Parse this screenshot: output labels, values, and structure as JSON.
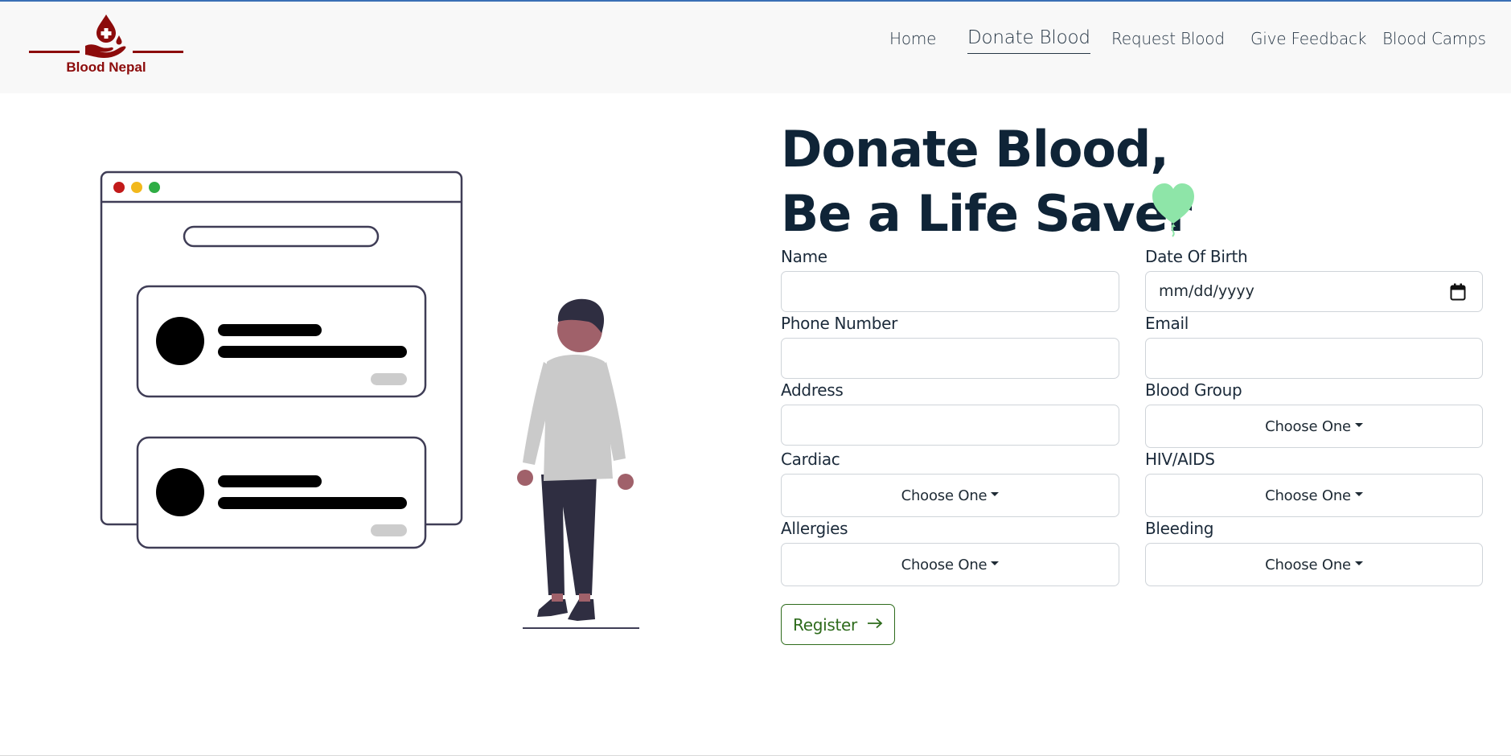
{
  "brand": {
    "name": "Blood Nepal",
    "logo_icon": "hand-blood-drop-icon",
    "color": "#8c0b0b"
  },
  "nav": {
    "items": [
      {
        "label": "Home",
        "active": false
      },
      {
        "label": "Donate Blood",
        "active": true
      },
      {
        "label": "Request Blood",
        "active": false
      },
      {
        "label": "Give Feedback",
        "active": false
      },
      {
        "label": "Blood Camps",
        "active": false
      }
    ]
  },
  "hero": {
    "title_line1": "Donate Blood,",
    "title_line2": "Be a Life Saver",
    "balloon_icon": "heart-balloon-icon",
    "balloon_color": "#8ee5a8"
  },
  "form": {
    "name": {
      "label": "Name",
      "value": "",
      "placeholder": ""
    },
    "dob": {
      "label": "Date Of Birth",
      "placeholder": "mm/dd/yyyy",
      "icon": "calendar-icon"
    },
    "phone": {
      "label": "Phone Number",
      "value": "",
      "placeholder": ""
    },
    "email": {
      "label": "Email",
      "value": "",
      "placeholder": ""
    },
    "address": {
      "label": "Address",
      "value": "",
      "placeholder": ""
    },
    "blood_group": {
      "label": "Blood Group",
      "selected": "Choose One"
    },
    "cardiac": {
      "label": "Cardiac",
      "selected": "Choose One"
    },
    "hiv": {
      "label": "HIV/AIDS",
      "selected": "Choose One"
    },
    "allergies": {
      "label": "Allergies",
      "selected": "Choose One"
    },
    "bleeding": {
      "label": "Bleeding",
      "selected": "Choose One"
    },
    "register": {
      "label": "Register",
      "icon": "arrow-right-icon",
      "color": "#2e6b1c"
    }
  },
  "colors": {
    "heading": "#0f2437",
    "nav_text": "#263645",
    "navbar_bg": "#f8f8f8",
    "top_accent": "#3a6fb5"
  }
}
